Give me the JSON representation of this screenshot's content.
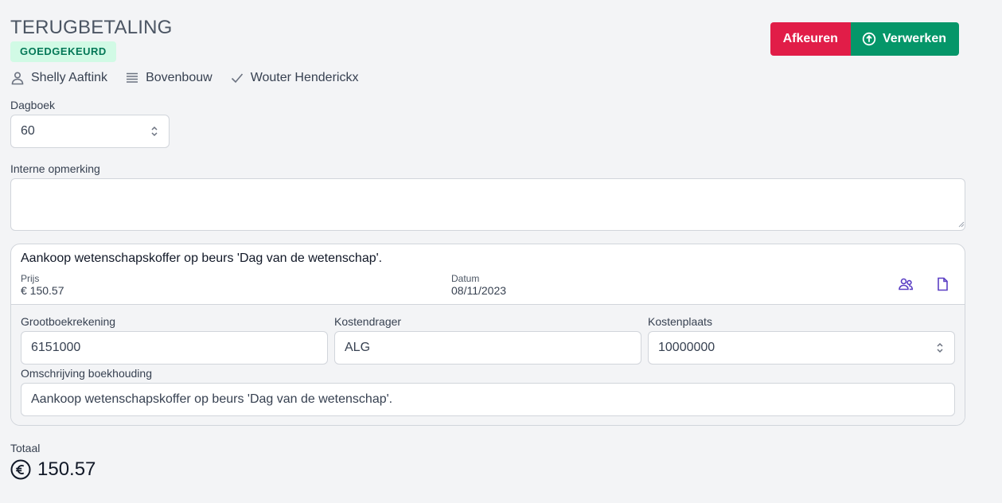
{
  "header": {
    "title": "TERUGBETALING",
    "status": "GOEDGEKEURD",
    "requester": "Shelly Aaftink",
    "department": "Bovenbouw",
    "approver": "Wouter Henderickx"
  },
  "actions": {
    "reject_label": "Afkeuren",
    "process_label": "Verwerken"
  },
  "journal": {
    "label": "Dagboek",
    "value": "60"
  },
  "internal_note": {
    "label": "Interne opmerking",
    "value": ""
  },
  "expense": {
    "description": "Aankoop wetenschapskoffer op beurs 'Dag van de wetenschap'.",
    "price_label": "Prijs",
    "price_value": "€ 150.57",
    "date_label": "Datum",
    "date_value": "08/11/2023",
    "ledger_label": "Grootboekrekening",
    "ledger_value": "6151000",
    "cost_carrier_label": "Kostendrager",
    "cost_carrier_value": "ALG",
    "cost_center_label": "Kostenplaats",
    "cost_center_value": "10000000",
    "accounting_desc_label": "Omschrijving boekhouding",
    "accounting_desc_value": "Aankoop wetenschapskoffer op beurs 'Dag van de wetenschap'."
  },
  "total": {
    "label": "Totaal",
    "value": "150.57"
  },
  "colors": {
    "reject": "#e11d48",
    "process": "#059669",
    "badge_bg": "#d1fae5",
    "badge_text": "#047857",
    "icon_accent": "#5b3fc4"
  }
}
